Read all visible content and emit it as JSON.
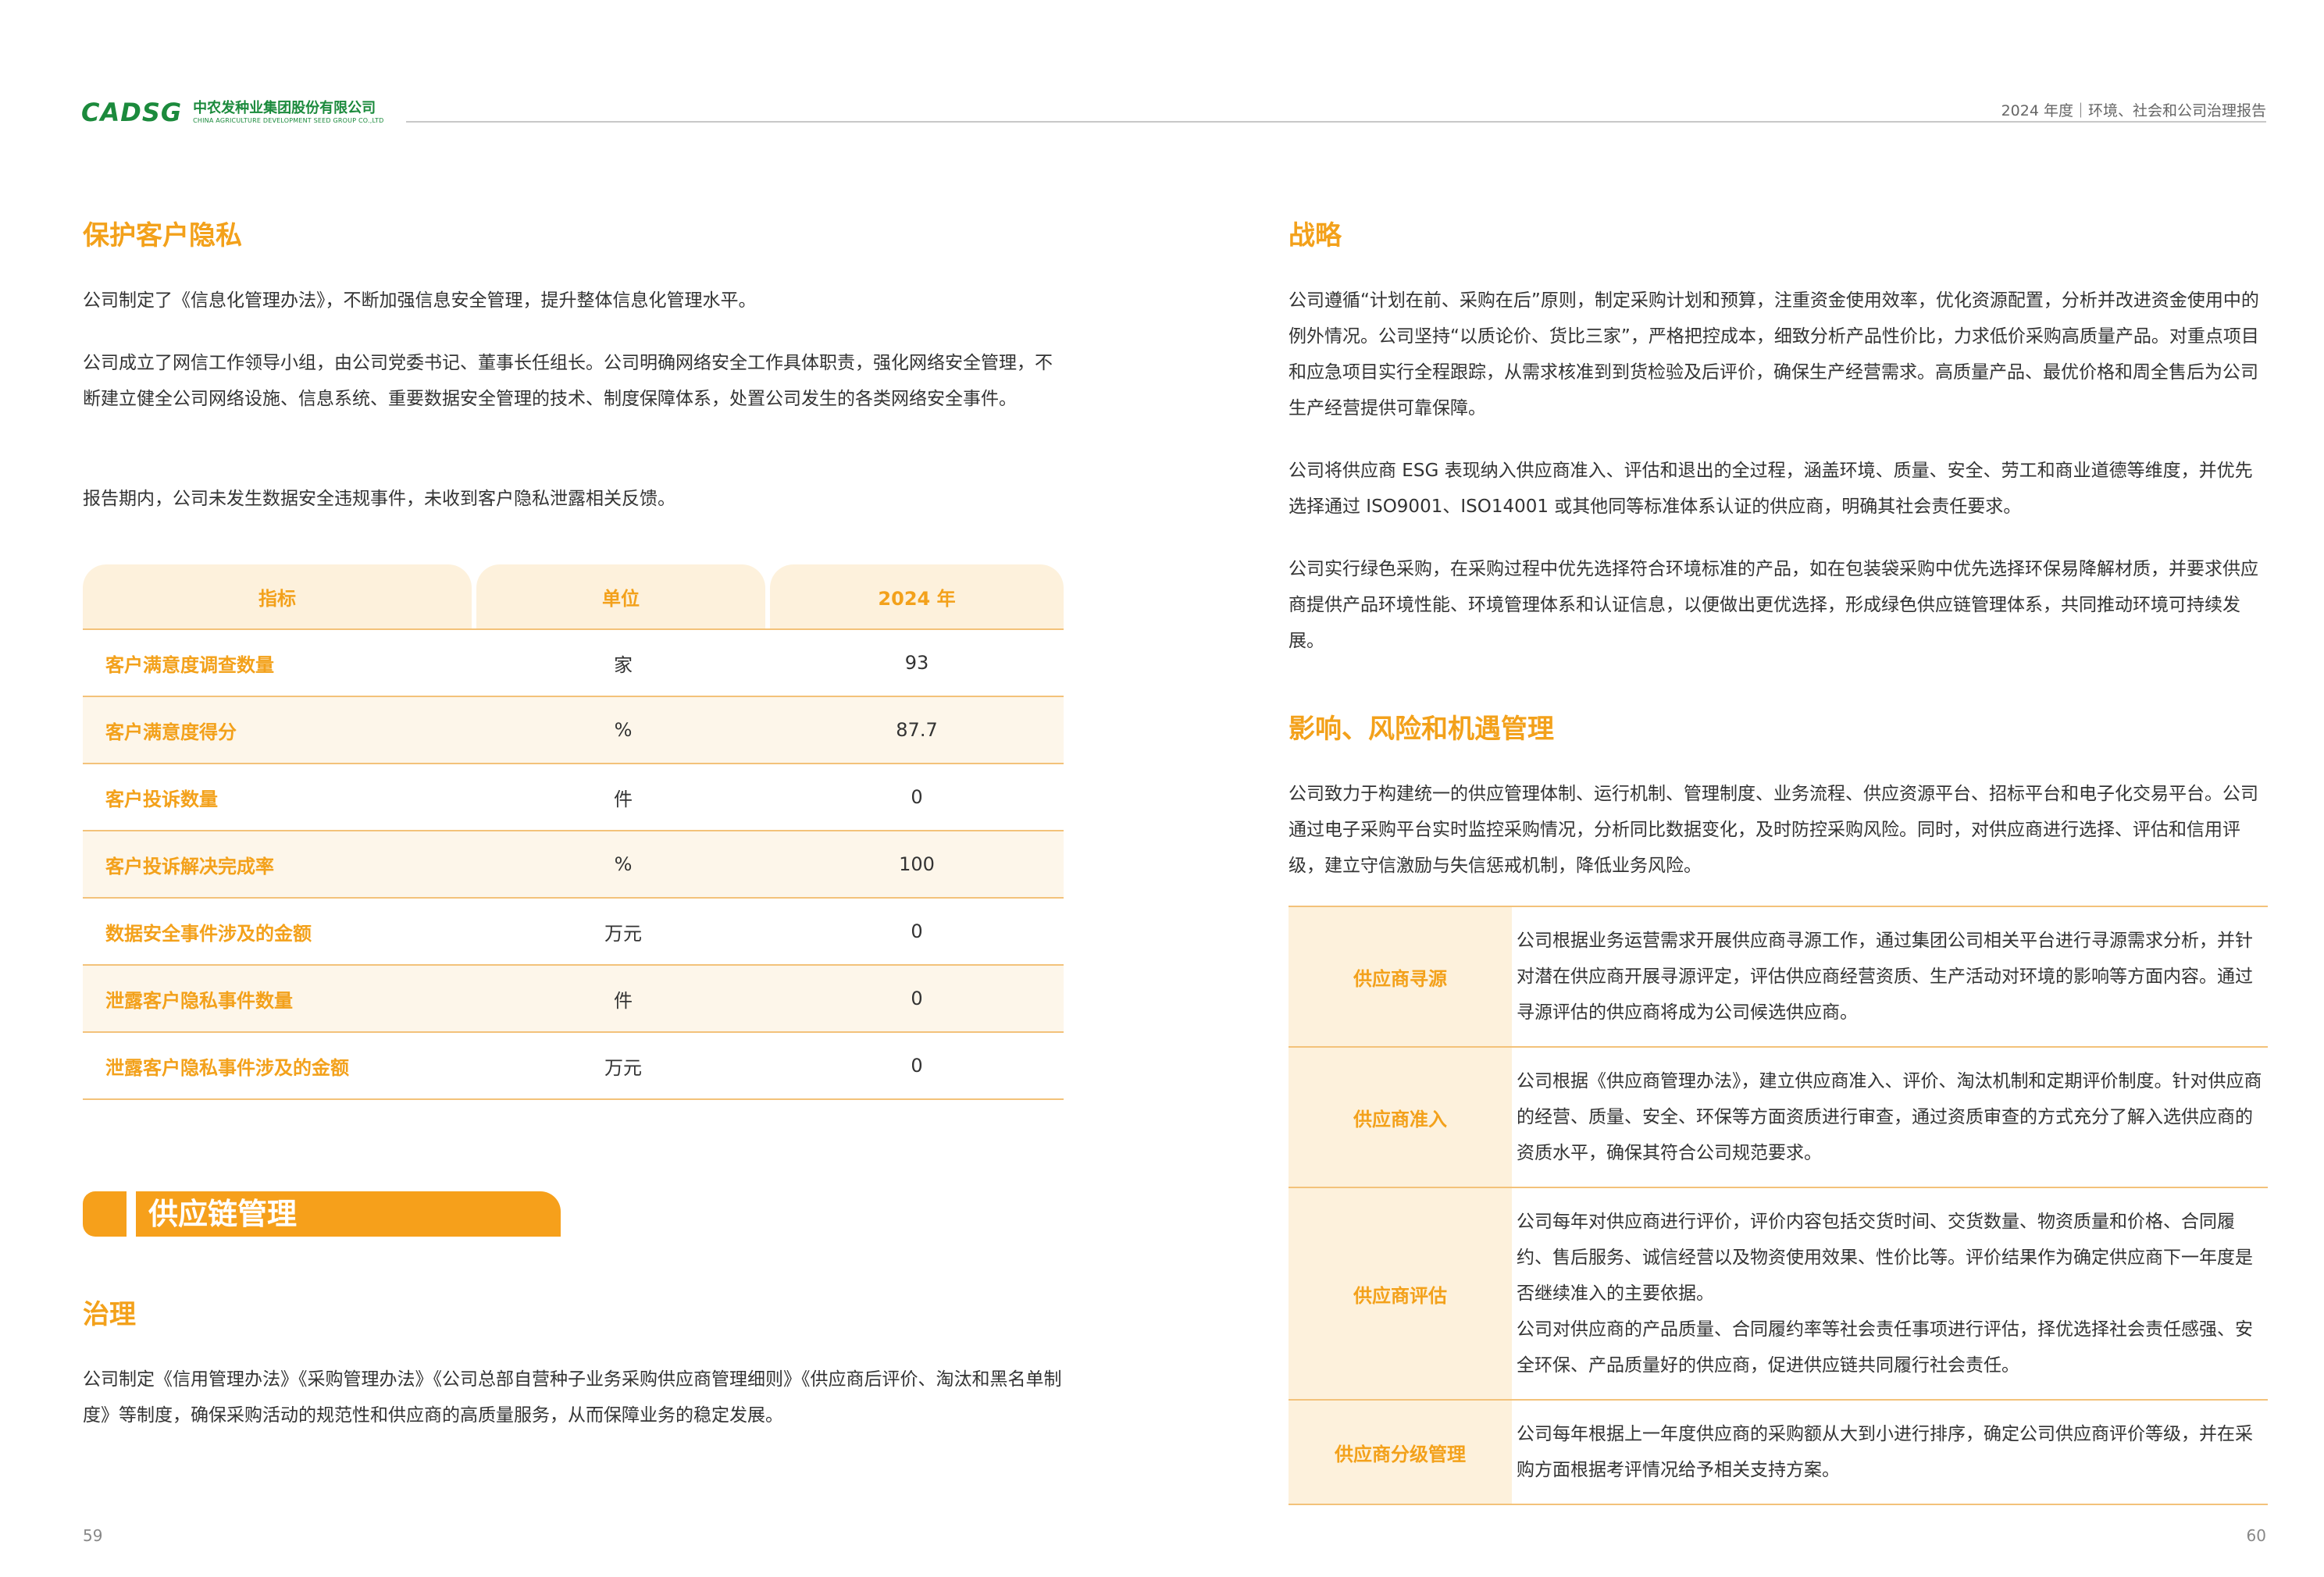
{
  "header": {
    "logo_mark": "CADSG",
    "company_cn": "中农发种业集团股份有限公司",
    "company_en": "CHINA AGRICULTURE DEVELOPMENT SEED GROUP CO.,LTD",
    "report_title": "2024 年度｜环境、社会和公司治理报告"
  },
  "left": {
    "privacy_heading": "保护客户隐私",
    "privacy_p1": "公司制定了《信息化管理办法》，不断加强信息安全管理，提升整体信息化管理水平。",
    "privacy_p2": "公司成立了网信工作领导小组，由公司党委书记、董事长任组长。公司明确网络安全工作具体职责，强化网络安全管理，不断建立健全公司网络设施、信息系统、重要数据安全管理的技术、制度保障体系，处置公司发生的各类网络安全事件。",
    "privacy_p3": "报告期内，公司未发生数据安全违规事件，未收到客户隐私泄露相关反馈。",
    "table": {
      "headers": [
        "指标",
        "单位",
        "2024 年"
      ],
      "rows": [
        {
          "name": "客户满意度调查数量",
          "unit": "家",
          "value": "93"
        },
        {
          "name": "客户满意度得分",
          "unit": "%",
          "value": "87.7"
        },
        {
          "name": "客户投诉数量",
          "unit": "件",
          "value": "0"
        },
        {
          "name": "客户投诉解决完成率",
          "unit": "%",
          "value": "100"
        },
        {
          "name": "数据安全事件涉及的金额",
          "unit": "万元",
          "value": "0"
        },
        {
          "name": "泄露客户隐私事件数量",
          "unit": "件",
          "value": "0"
        },
        {
          "name": "泄露客户隐私事件涉及的金额",
          "unit": "万元",
          "value": "0"
        }
      ]
    },
    "section_banner": "供应链管理",
    "governance_heading": "治理",
    "governance_p1": "公司制定《信用管理办法》《采购管理办法》《公司总部自营种子业务采购供应商管理细则》《供应商后评价、淘汰和黑名单制度》等制度，确保采购活动的规范性和供应商的高质量服务，从而保障业务的稳定发展。",
    "page_number": "59"
  },
  "right": {
    "strategy_heading": "战略",
    "strategy_p1": "公司遵循“计划在前、采购在后”原则，制定采购计划和预算，注重资金使用效率，优化资源配置，分析并改进资金使用中的例外情况。公司坚持“以质论价、货比三家”，严格把控成本，细致分析产品性价比，力求低价采购高质量产品。对重点项目和应急项目实行全程跟踪，从需求核准到到货检验及后评价，确保生产经营需求。高质量产品、最优价格和周全售后为公司生产经营提供可靠保障。",
    "strategy_p2": "公司将供应商 ESG 表现纳入供应商准入、评估和退出的全过程，涵盖环境、质量、安全、劳工和商业道德等维度，并优先选择通过 ISO9001、ISO14001 或其他同等标准体系认证的供应商，明确其社会责任要求。",
    "strategy_p3": "公司实行绿色采购，在采购过程中优先选择符合环境标准的产品，如在包装袋采购中优先选择环保易降解材质，并要求供应商提供产品环境性能、环境管理体系和认证信息，以便做出更优选择，形成绿色供应链管理体系，共同推动环境可持续发展。",
    "impact_heading": "影响、风险和机遇管理",
    "impact_p1": "公司致力于构建统一的供应管理体制、运行机制、管理制度、业务流程、供应资源平台、招标平台和电子化交易平台。公司通过电子采购平台实时监控采购情况，分析同比数据变化，及时防控采购风险。同时，对供应商进行选择、评估和信用评级，建立守信激励与失信惩戒机制，降低业务风险。",
    "table": [
      {
        "label": "供应商寻源",
        "lines": [
          "公司根据业务运营需求开展供应商寻源工作，通过集团公司相关平台进行寻源需求分析，并针对潜在供应商开展寻源评定，评估供应商经营资质、生产活动对环境的影响等方面内容。通过寻源评估的供应商将成为公司候选供应商。"
        ]
      },
      {
        "label": "供应商准入",
        "lines": [
          "公司根据《供应商管理办法》，建立供应商准入、评价、淘汰机制和定期评价制度。针对供应商的经营、质量、安全、环保等方面资质进行审查，通过资质审查的方式充分了解入选供应商的资质水平，确保其符合公司规范要求。"
        ]
      },
      {
        "label": "供应商评估",
        "lines": [
          "公司每年对供应商进行评价，评价内容包括交货时间、交货数量、物资质量和价格、合同履约、售后服务、诚信经营以及物资使用效果、性价比等。评价结果作为确定供应商下一年度是否继续准入的主要依据。",
          "公司对供应商的产品质量、合同履约率等社会责任事项进行评估，择优选择社会责任感强、安全环保、产品质量好的供应商，促进供应链共同履行社会责任。"
        ]
      },
      {
        "label": "供应商分级管理",
        "lines": [
          "公司每年根据上一年度供应商的采购额从大到小进行排序，确定公司供应商评价等级，并在采购方面根据考评情况给予相关支持方案。"
        ]
      }
    ],
    "page_number": "60"
  }
}
